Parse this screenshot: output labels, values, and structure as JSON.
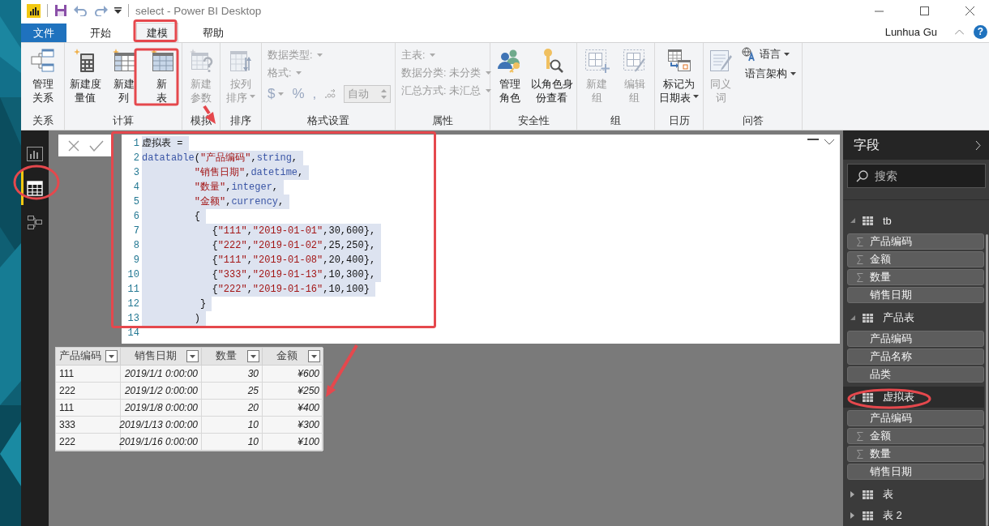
{
  "title_bar": {
    "title": "select - Power BI Desktop"
  },
  "tabs": [
    {
      "label": "文件",
      "kind": "file",
      "selected": false
    },
    {
      "label": "开始",
      "kind": "tab",
      "selected": false
    },
    {
      "label": "建模",
      "kind": "tab",
      "selected": true
    },
    {
      "label": "帮助",
      "kind": "tab",
      "selected": false
    }
  ],
  "user": {
    "name": "Lunhua Gu",
    "help": "?"
  },
  "ribbon": {
    "groups": [
      {
        "label": "关系",
        "items": [
          {
            "kind": "large",
            "lines": [
              "管理",
              "关系"
            ],
            "disabled": false,
            "caret": false
          }
        ]
      },
      {
        "label": "计算",
        "items": [
          {
            "kind": "large",
            "lines": [
              "新建度",
              "量值"
            ],
            "disabled": false,
            "caret": false
          },
          {
            "kind": "large",
            "lines": [
              "新建",
              "列"
            ],
            "disabled": false,
            "caret": false
          },
          {
            "kind": "large",
            "lines": [
              "新",
              "表"
            ],
            "disabled": false,
            "caret": false
          }
        ]
      },
      {
        "label": "模拟",
        "items": [
          {
            "kind": "large",
            "lines": [
              "新建",
              "参数"
            ],
            "disabled": true,
            "caret": false
          }
        ]
      },
      {
        "label": "排序",
        "items": [
          {
            "kind": "large",
            "lines": [
              "按列",
              "排序"
            ],
            "disabled": true,
            "caret": true
          }
        ]
      },
      {
        "label": "格式设置",
        "items": [
          {
            "kind": "dropdown",
            "label": "数据类型:",
            "disabled": true
          },
          {
            "kind": "dropdown",
            "label": "格式:",
            "disabled": true
          },
          {
            "kind": "format_row",
            "symbols": [
              {
                "text": "$",
                "caret": true
              },
              {
                "text": "%",
                "caret": false
              },
              {
                "text": ",",
                "caret": false
              }
            ],
            "spin_value": "自动",
            "disabled": true
          }
        ]
      },
      {
        "label": "属性",
        "items": [
          {
            "kind": "dropdown",
            "label": "主表:",
            "disabled": true
          },
          {
            "kind": "dropdown",
            "label": "数据分类:",
            "value": "未分类",
            "disabled": true
          },
          {
            "kind": "dropdown",
            "label": "汇总方式:",
            "value": "未汇总",
            "disabled": true
          }
        ]
      },
      {
        "label": "安全性",
        "items": [
          {
            "kind": "large",
            "lines": [
              "管理",
              "角色"
            ],
            "disabled": false,
            "caret": false
          },
          {
            "kind": "large",
            "lines": [
              "以角色身",
              "份查看"
            ],
            "disabled": false,
            "caret": false
          }
        ]
      },
      {
        "label": "组",
        "items": [
          {
            "kind": "large",
            "lines": [
              "新建",
              "组"
            ],
            "disabled": true,
            "caret": false
          },
          {
            "kind": "large",
            "lines": [
              "编辑",
              "组"
            ],
            "disabled": true,
            "caret": false
          }
        ]
      },
      {
        "label": "日历",
        "items": [
          {
            "kind": "large",
            "lines": [
              "标记为",
              "日期表"
            ],
            "disabled": false,
            "caret": true
          }
        ]
      },
      {
        "label": "问答",
        "items": [
          {
            "kind": "large",
            "lines": [
              "同义",
              "词"
            ],
            "disabled": true,
            "caret": false
          },
          {
            "kind": "small",
            "label": "语言",
            "disabled": false,
            "caret": true
          },
          {
            "kind": "small",
            "label": "语言架构",
            "disabled": false,
            "caret": true
          }
        ]
      }
    ]
  },
  "nav": [
    {
      "kind": "report",
      "selected": false
    },
    {
      "kind": "data",
      "selected": true
    },
    {
      "kind": "model",
      "selected": false
    }
  ],
  "editor": {
    "lines": [
      {
        "number": "1",
        "selected": true,
        "tokens": [
          {
            "text": "虚拟表 =",
            "kind": "plain"
          }
        ]
      },
      {
        "number": "2",
        "selected": true,
        "tokens": [
          {
            "text": "datatable",
            "kind": "keyword"
          },
          {
            "text": "(",
            "kind": "plain"
          },
          {
            "text": "\"产品编码\"",
            "kind": "string"
          },
          {
            "text": ",",
            "kind": "plain"
          },
          {
            "text": "string",
            "kind": "keyword"
          },
          {
            "text": ",",
            "kind": "plain"
          }
        ]
      },
      {
        "number": "3",
        "selected": true,
        "tokens": [
          {
            "text": "         \"销售日期\"",
            "kind": "string"
          },
          {
            "text": ",",
            "kind": "plain"
          },
          {
            "text": "datetime",
            "kind": "keyword"
          },
          {
            "text": ",",
            "kind": "plain"
          }
        ]
      },
      {
        "number": "4",
        "selected": true,
        "tokens": [
          {
            "text": "         \"数量\"",
            "kind": "string"
          },
          {
            "text": ",",
            "kind": "plain"
          },
          {
            "text": "integer",
            "kind": "keyword"
          },
          {
            "text": ",",
            "kind": "plain"
          }
        ]
      },
      {
        "number": "5",
        "selected": true,
        "tokens": [
          {
            "text": "         \"金额\"",
            "kind": "string"
          },
          {
            "text": ",",
            "kind": "plain"
          },
          {
            "text": "currency",
            "kind": "keyword"
          },
          {
            "text": ",",
            "kind": "plain"
          }
        ]
      },
      {
        "number": "6",
        "selected": true,
        "tokens": [
          {
            "text": "         {",
            "kind": "plain"
          }
        ]
      },
      {
        "number": "7",
        "selected": true,
        "tokens": [
          {
            "text": "            {",
            "kind": "plain"
          },
          {
            "text": "\"111\"",
            "kind": "string"
          },
          {
            "text": ",",
            "kind": "plain"
          },
          {
            "text": "\"2019-01-01\"",
            "kind": "string"
          },
          {
            "text": ",30,600},",
            "kind": "plain"
          }
        ]
      },
      {
        "number": "8",
        "selected": true,
        "tokens": [
          {
            "text": "            {",
            "kind": "plain"
          },
          {
            "text": "\"222\"",
            "kind": "string"
          },
          {
            "text": ",",
            "kind": "plain"
          },
          {
            "text": "\"2019-01-02\"",
            "kind": "string"
          },
          {
            "text": ",25,250},",
            "kind": "plain"
          }
        ]
      },
      {
        "number": "9",
        "selected": true,
        "tokens": [
          {
            "text": "            {",
            "kind": "plain"
          },
          {
            "text": "\"111\"",
            "kind": "string"
          },
          {
            "text": ",",
            "kind": "plain"
          },
          {
            "text": "\"2019-01-08\"",
            "kind": "string"
          },
          {
            "text": ",20,400},",
            "kind": "plain"
          }
        ]
      },
      {
        "number": "10",
        "selected": true,
        "tokens": [
          {
            "text": "            {",
            "kind": "plain"
          },
          {
            "text": "\"333\"",
            "kind": "string"
          },
          {
            "text": ",",
            "kind": "plain"
          },
          {
            "text": "\"2019-01-13\"",
            "kind": "string"
          },
          {
            "text": ",10,300},",
            "kind": "plain"
          }
        ]
      },
      {
        "number": "11",
        "selected": true,
        "tokens": [
          {
            "text": "            {",
            "kind": "plain"
          },
          {
            "text": "\"222\"",
            "kind": "string"
          },
          {
            "text": ",",
            "kind": "plain"
          },
          {
            "text": "\"2019-01-16\"",
            "kind": "string"
          },
          {
            "text": ",10,100}",
            "kind": "plain"
          }
        ]
      },
      {
        "number": "12",
        "selected": true,
        "tokens": [
          {
            "text": "          }",
            "kind": "plain"
          }
        ]
      },
      {
        "number": "13",
        "selected": true,
        "tokens": [
          {
            "text": "         )",
            "kind": "plain"
          }
        ]
      },
      {
        "number": "14",
        "selected": false
      }
    ]
  },
  "table": {
    "columns": [
      {
        "label": "产品编码",
        "kind": "text"
      },
      {
        "label": "销售日期",
        "kind": "date"
      },
      {
        "label": "数量",
        "kind": "number"
      },
      {
        "label": "金额",
        "kind": "currency"
      }
    ],
    "rows": [
      [
        "111",
        "2019/1/1 0:00:00",
        "30",
        "¥600"
      ],
      [
        "222",
        "2019/1/2 0:00:00",
        "25",
        "¥250"
      ],
      [
        "111",
        "2019/1/8 0:00:00",
        "20",
        "¥400"
      ],
      [
        "333",
        "2019/1/13 0:00:00",
        "10",
        "¥300"
      ],
      [
        "222",
        "2019/1/16 0:00:00",
        "10",
        "¥100"
      ]
    ]
  },
  "fields_pane": {
    "title": "字段",
    "search": {
      "placeholder": "搜索"
    },
    "tables": [
      {
        "name": "tb",
        "expanded": true,
        "selected": false,
        "children": [
          {
            "name": "产品编码",
            "summable": true
          },
          {
            "name": "金额",
            "summable": true
          },
          {
            "name": "数量",
            "summable": true
          },
          {
            "name": "销售日期",
            "summable": false
          }
        ]
      },
      {
        "name": "产品表",
        "expanded": true,
        "selected": false,
        "children": [
          {
            "name": "产品编码",
            "summable": false
          },
          {
            "name": "产品名称",
            "summable": false
          },
          {
            "name": "品类",
            "summable": false
          }
        ]
      },
      {
        "name": "虚拟表",
        "expanded": true,
        "selected": true,
        "children": [
          {
            "name": "产品编码",
            "summable": false
          },
          {
            "name": "金额",
            "summable": true
          },
          {
            "name": "数量",
            "summable": true
          },
          {
            "name": "销售日期",
            "summable": false
          }
        ]
      },
      {
        "name": "表",
        "expanded": false,
        "selected": false
      },
      {
        "name": "表 2",
        "expanded": false,
        "selected": false
      }
    ]
  }
}
